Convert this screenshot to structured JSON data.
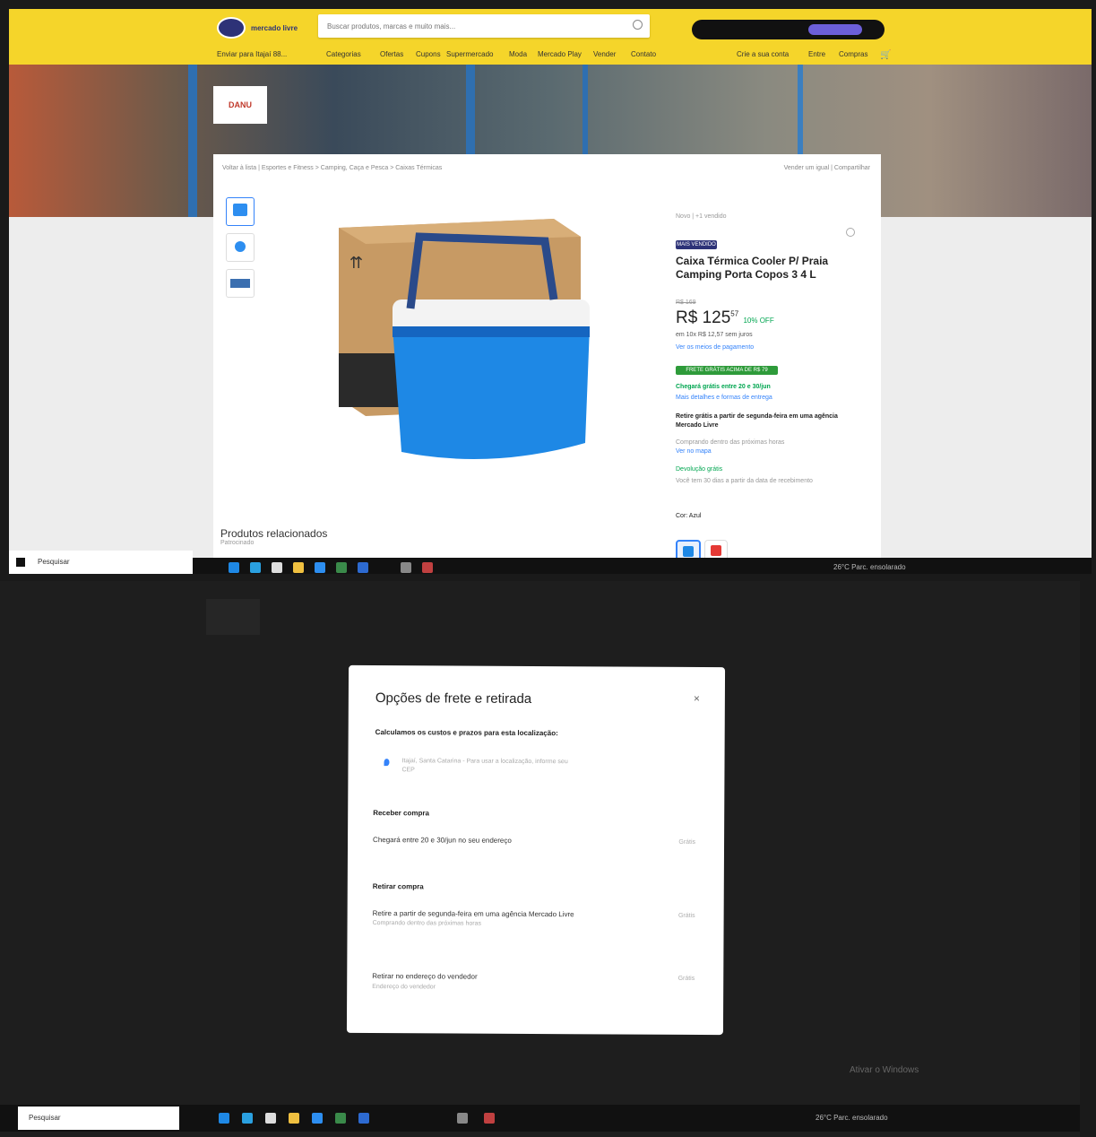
{
  "header": {
    "logo_text": "mercado livre",
    "search_placeholder": "Buscar produtos, marcas e muito mais...",
    "location": "Enviar para Itajaí 88...",
    "nav_items": [
      "Categorias",
      "Ofertas",
      "Cupons",
      "Supermercado",
      "Moda",
      "Mercado Play",
      "Vender",
      "Contato"
    ],
    "user_items": [
      "Crie a sua conta",
      "Entre",
      "Compras"
    ]
  },
  "store": {
    "logo_text": "DANU"
  },
  "product": {
    "breadcrumb": "Voltar à lista | Esportes e Fitness > Camping, Caça e Pesca > Caixas Térmicas",
    "share": "Vender um igual | Compartilhar",
    "sold": "Novo | +1 vendido",
    "badge": "MAIS VENDIDO",
    "title": "Caixa Térmica Cooler P/ Praia Camping Porta Copos 3 4 L",
    "old_price": "R$ 169",
    "price": "R$ 125",
    "price_cents": "57",
    "discount": "10% OFF",
    "installments": "em 10x R$ 12,57 sem juros",
    "payment_link": "Ver os meios de pagamento",
    "shipping_tag": "FRETE GRÁTIS ACIMA DE R$ 79",
    "delivery": "Chegará grátis entre 20 e 30/jun",
    "delivery_sub": "Mais detalhes e formas de entrega",
    "pickup": "Retire grátis a partir de segunda-feira em uma agência Mercado Livre",
    "pickup_sub": "Comprando dentro das próximas horas",
    "pickup_link": "Ver no mapa",
    "returns": "Devolução grátis",
    "returns_sub": "Você tem 30 dias a partir da data de recebimento",
    "color_label": "Cor: Azul",
    "related": "Produtos relacionados",
    "related_sub": "Patrocinado"
  },
  "taskbar": {
    "search_label": "Pesquisar",
    "weather": "26°C Parc. ensolarado"
  },
  "modal": {
    "title": "Opções de frete e retirada",
    "close": "×",
    "subtitle": "Calculamos os custos e prazos para esta localização:",
    "location_text": "Itajaí, Santa Catarina - Para usar a localização, informe seu CEP",
    "section_receive": "Receber compra",
    "receive_line": "Chegará entre 20 e 30/jun no seu endereço",
    "receive_price": "Grátis",
    "section_pickup": "Retirar compra",
    "pickup_line": "Retire a partir de segunda-feira em uma agência Mercado Livre",
    "pickup_sub": "Comprando dentro das próximas horas",
    "pickup_price": "Grátis",
    "other_line": "Retirar no endereço do vendedor",
    "other_sub": "Endereço do vendedor",
    "other_price": "Grátis"
  },
  "watermark": "Ativar o Windows"
}
